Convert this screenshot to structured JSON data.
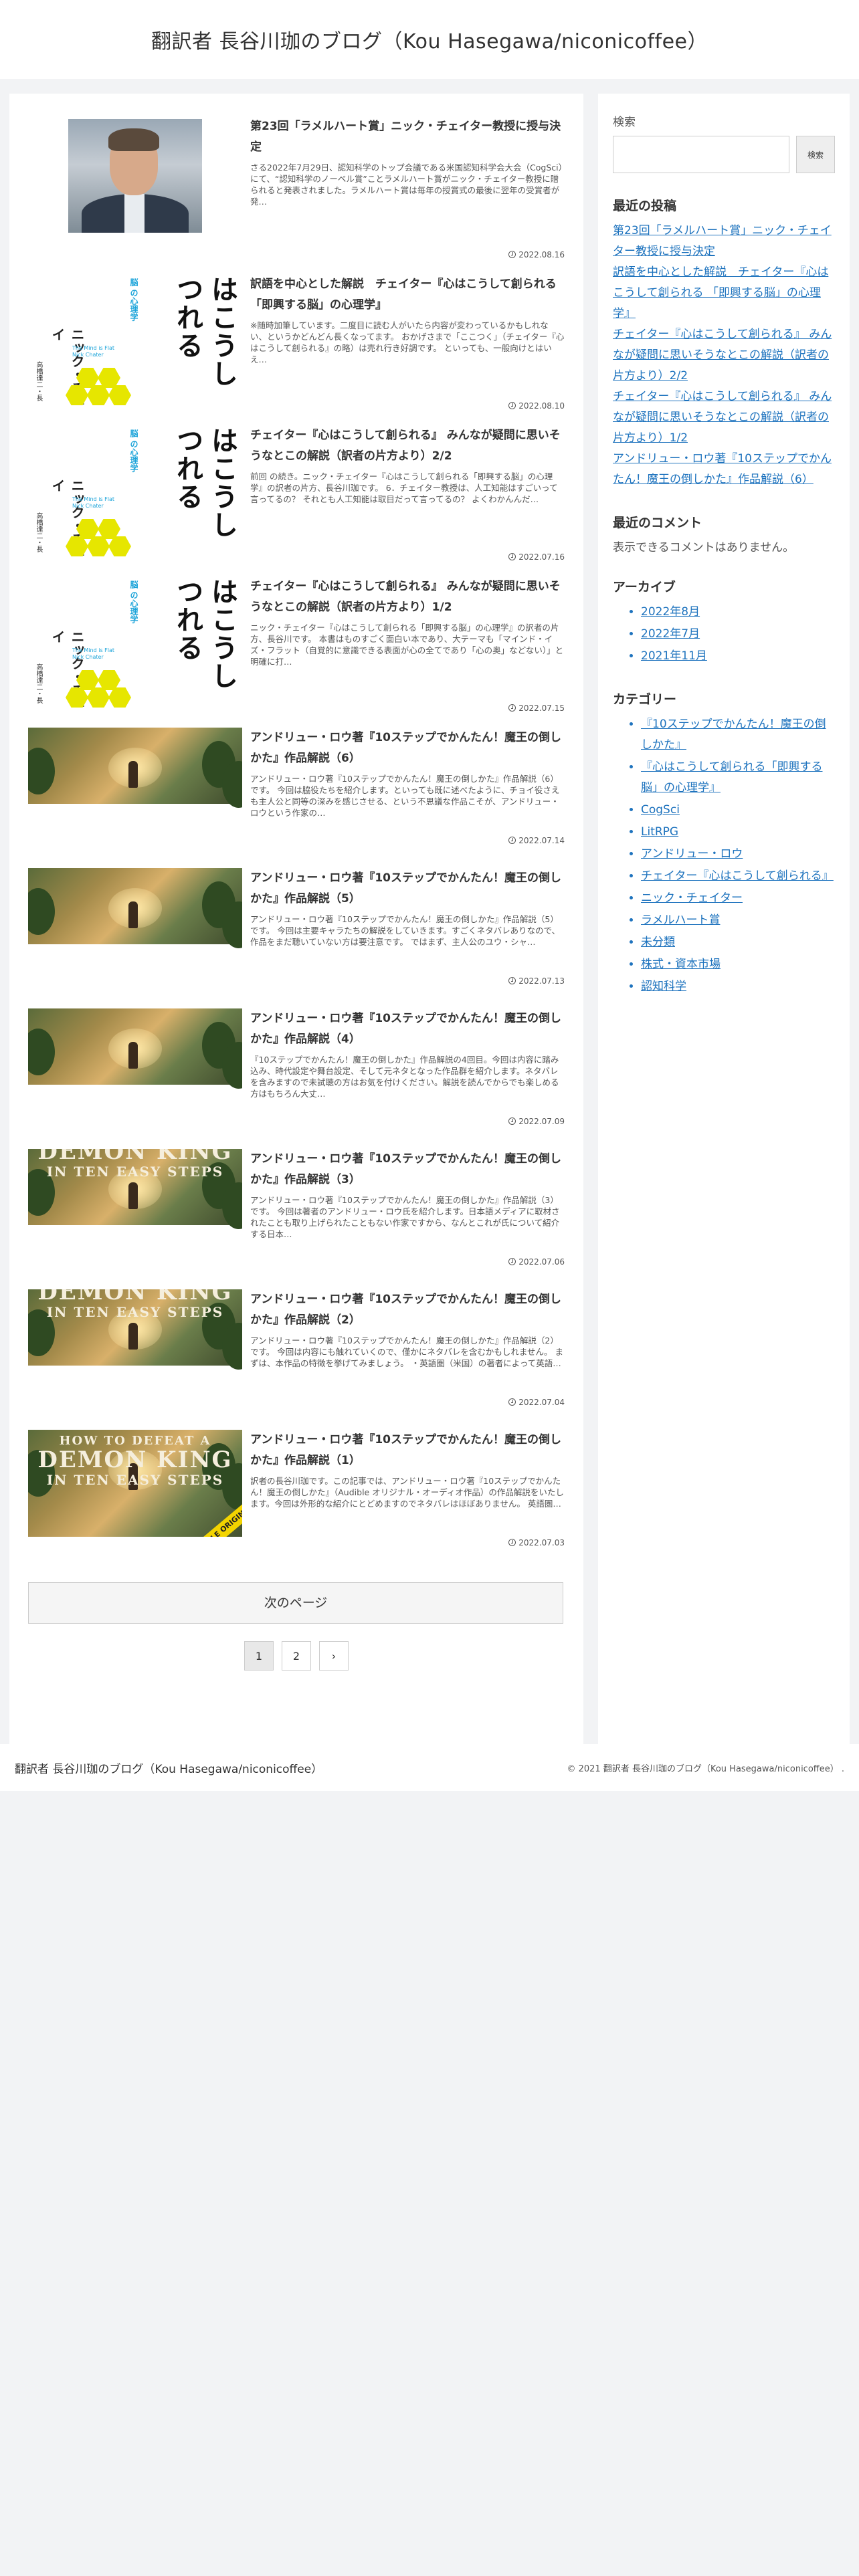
{
  "header": {
    "site_title": "翻訳者 長谷川珈のブログ（Kou Hasegawa/niconicoffee）"
  },
  "posts": [
    {
      "title": "第23回「ラメルハート賞」ニック・チェイター教授に授与決定",
      "snippet": "さる2022年7月29日、認知科学のトップ会議である米国認知科学会大会（CogSci）にて、“認知科学のノーベル賞”ことラメルハート賞がニック・チェイター教授に贈られると発表されました。ラメルハート賞は毎年の授賞式の最後に翌年の受賞者が発…",
      "date": "2022.08.16",
      "thumb": "photo"
    },
    {
      "title": "訳語を中心とした解説　チェイター『心はこうして創られる 「即興する脳」の心理学』",
      "snippet": "※随時加筆しています。二度目に読む人がいたら内容が変わっているかもしれない、というかどんどん長くなってます。 おかげさまで「ここつく」（チェイター『心はこうして創られる』の略）は売れ行き好調です。 といっても、一般向けとはいえ…",
      "date": "2022.08.10",
      "thumb": "book"
    },
    {
      "title": "チェイター『心はこうして創られる』 みんなが疑問に思いそうなとこの解説（訳者の片方より）2/2",
      "snippet": "前回 の続き。ニック・チェイター『心はこうして創られる「即興する脳」の心理学』の訳者の片方、長谷川珈です。 6．チェイター教授は、人工知能はすごいって言ってるの？ それとも人工知能は取目だって言ってるの？ よくわかんんだ…",
      "date": "2022.07.16",
      "thumb": "book"
    },
    {
      "title": "チェイター『心はこうして創られる』 みんなが疑問に思いそうなとこの解説（訳者の片方より）1/2",
      "snippet": "ニック・チェイター『心はこうして創られる「即興する脳」の心理学』の訳者の片方、長谷川です。 本書はものすごく面白い本であり、大テーマも「マインド・イズ・フラット（自覚的に意識できる表面が心の全てであり「心の奥」などない）」と明確に打…",
      "date": "2022.07.15",
      "thumb": "book"
    },
    {
      "title": "アンドリュー・ロウ著『10ステップでかんたん！魔王の倒しかた』作品解説（6）",
      "snippet": "アンドリュー・ロウ著『10ステップでかんたん！魔王の倒しかた』作品解説（6）です。 今回は脇役たちを紹介します。といっても既に述べたように、チョイ役さえも主人公と同等の深みを感じさせる、という不思議な作品こそが、アンドリュー・ロウという作家の…",
      "date": "2022.07.14",
      "thumb": "game"
    },
    {
      "title": "アンドリュー・ロウ著『10ステップでかんたん！魔王の倒しかた』作品解説（5）",
      "snippet": "アンドリュー・ロウ著『10ステップでかんたん！魔王の倒しかた』作品解説（5）です。 今回は主要キャラたちの解説をしていきます。すごくネタバレありなので、作品をまだ聴いていない方は要注意です。 ではまず、主人公のユウ・シャ…",
      "date": "2022.07.13",
      "thumb": "game"
    },
    {
      "title": "アンドリュー・ロウ著『10ステップでかんたん！魔王の倒しかた』作品解説（4）",
      "snippet": "『10ステップでかんたん！魔王の倒しかた』作品解説の4回目。今回は内容に踏み込み、時代設定や舞台設定、そして元ネタとなった作品群を紹介します。ネタバレを含みますので未試聴の方はお気を付けください。解説を読んでからでも楽しめる方はもちろん大丈…",
      "date": "2022.07.09",
      "thumb": "game"
    },
    {
      "title": "アンドリュー・ロウ著『10ステップでかんたん！魔王の倒しかた』作品解説（3）",
      "snippet": "アンドリュー・ロウ著『10ステップでかんたん！魔王の倒しかた』作品解説（3）です。 今回は著者のアンドリュー・ロウ氏を紹介します。日本語メディアに取材されたことも取り上げられたこともない作家ですから、なんとこれが氏について紹介する日本…",
      "date": "2022.07.06",
      "thumb": "game-logo"
    },
    {
      "title": "アンドリュー・ロウ著『10ステップでかんたん！魔王の倒しかた』作品解説（2）",
      "snippet": "アンドリュー・ロウ著『10ステップでかんたん！魔王の倒しかた』作品解説（2）です。 今回は内容にも触れていくので、僅かにネタバレを含むかもしれません。 まずは、本作品の特徴を挙げてみましょう。 ・英語圏（米国）の著者によって英語…",
      "date": "2022.07.04",
      "thumb": "game-logo"
    },
    {
      "title": "アンドリュー・ロウ著『10ステップでかんたん！魔王の倒しかた』作品解説（1）",
      "snippet": "訳者の長谷川珈です。この記事では、アンドリュー・ロウ著『10ステップでかんたん！魔王の倒しかた』（Audible オリジナル・オーディオ作品）の作品解説をいたします。今回は外形的な紹介にとどめますのでネタバレはほぼありません。 英語圏…",
      "date": "2022.07.03",
      "thumb": "game-full"
    }
  ],
  "book": {
    "big": "はこうし\nつれる",
    "sub": "脳 の心理学",
    "author": "ニック・チェイ",
    "translator": "高橋達二・長",
    "en": "The Mind is Flat\nNick Chater"
  },
  "game": {
    "logo_top": "HOW TO DEFEAT A",
    "logo_mid": "DEMON KING",
    "logo_bot": "IN TEN EASY STEPS",
    "ribbon": "AUDIBLE ORIGINAL"
  },
  "pagination": {
    "next_label": "次のページ",
    "pages": [
      "1",
      "2"
    ],
    "next_arrow": "›"
  },
  "sidebar": {
    "search_label": "検索",
    "search_placeholder": "",
    "search_button": "検索",
    "recent_title": "最近の投稿",
    "recent_posts": [
      "第23回「ラメルハート賞」ニック・チェイター教授に授与決定",
      "訳語を中心とした解説　チェイター『心はこうして創られる 「即興する脳」の心理学』",
      "チェイター『心はこうして創られる』 みんなが疑問に思いそうなとこの解説（訳者の片方より）2/2",
      "チェイター『心はこうして創られる』 みんなが疑問に思いそうなとこの解説（訳者の片方より）1/2",
      "アンドリュー・ロウ著『10ステップでかんたん！魔王の倒しかた』作品解説（6）"
    ],
    "comments_title": "最近のコメント",
    "no_comments": "表示できるコメントはありません。",
    "archive_title": "アーカイブ",
    "archives": [
      "2022年8月",
      "2022年7月",
      "2021年11月"
    ],
    "category_title": "カテゴリー",
    "categories": [
      "『10ステップでかんたん！魔王の倒しかた』",
      "『心はこうして創られる「即興する脳」の心理学』",
      "CogSci",
      "LitRPG",
      "アンドリュー・ロウ",
      "チェイター『心はこうして創られる』",
      "ニック・チェイター",
      "ラメルハート賞",
      "未分類",
      "株式・資本市場",
      "認知科学"
    ]
  },
  "footer": {
    "left": "翻訳者 長谷川珈のブログ（Kou Hasegawa/niconicoffee）",
    "right": "© 2021 翻訳者 長谷川珈のブログ（Kou Hasegawa/niconicoffee） ."
  },
  "colors": {
    "link": "#1e73be",
    "background": "#f2f3f5"
  }
}
